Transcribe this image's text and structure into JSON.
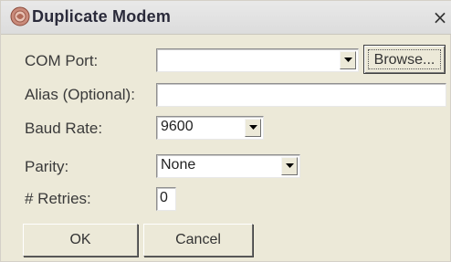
{
  "window": {
    "title": "Duplicate Modem",
    "close_glyph": "×",
    "icon": "modem-app-icon"
  },
  "form": {
    "com_port": {
      "label": "COM Port:",
      "value": "",
      "browse_label": "Browse..."
    },
    "alias": {
      "label": "Alias (Optional):",
      "value": ""
    },
    "baud_rate": {
      "label": "Baud Rate:",
      "value": "9600"
    },
    "parity": {
      "label": "Parity:",
      "value": "None"
    },
    "retries": {
      "label": "# Retries:",
      "value": "0"
    }
  },
  "buttons": {
    "ok_label": "OK",
    "cancel_label": "Cancel"
  },
  "colors": {
    "dialog_bg": "#ece9d8",
    "titlebar_bg": "#dcdcdc",
    "field_bg": "#ffffff"
  }
}
